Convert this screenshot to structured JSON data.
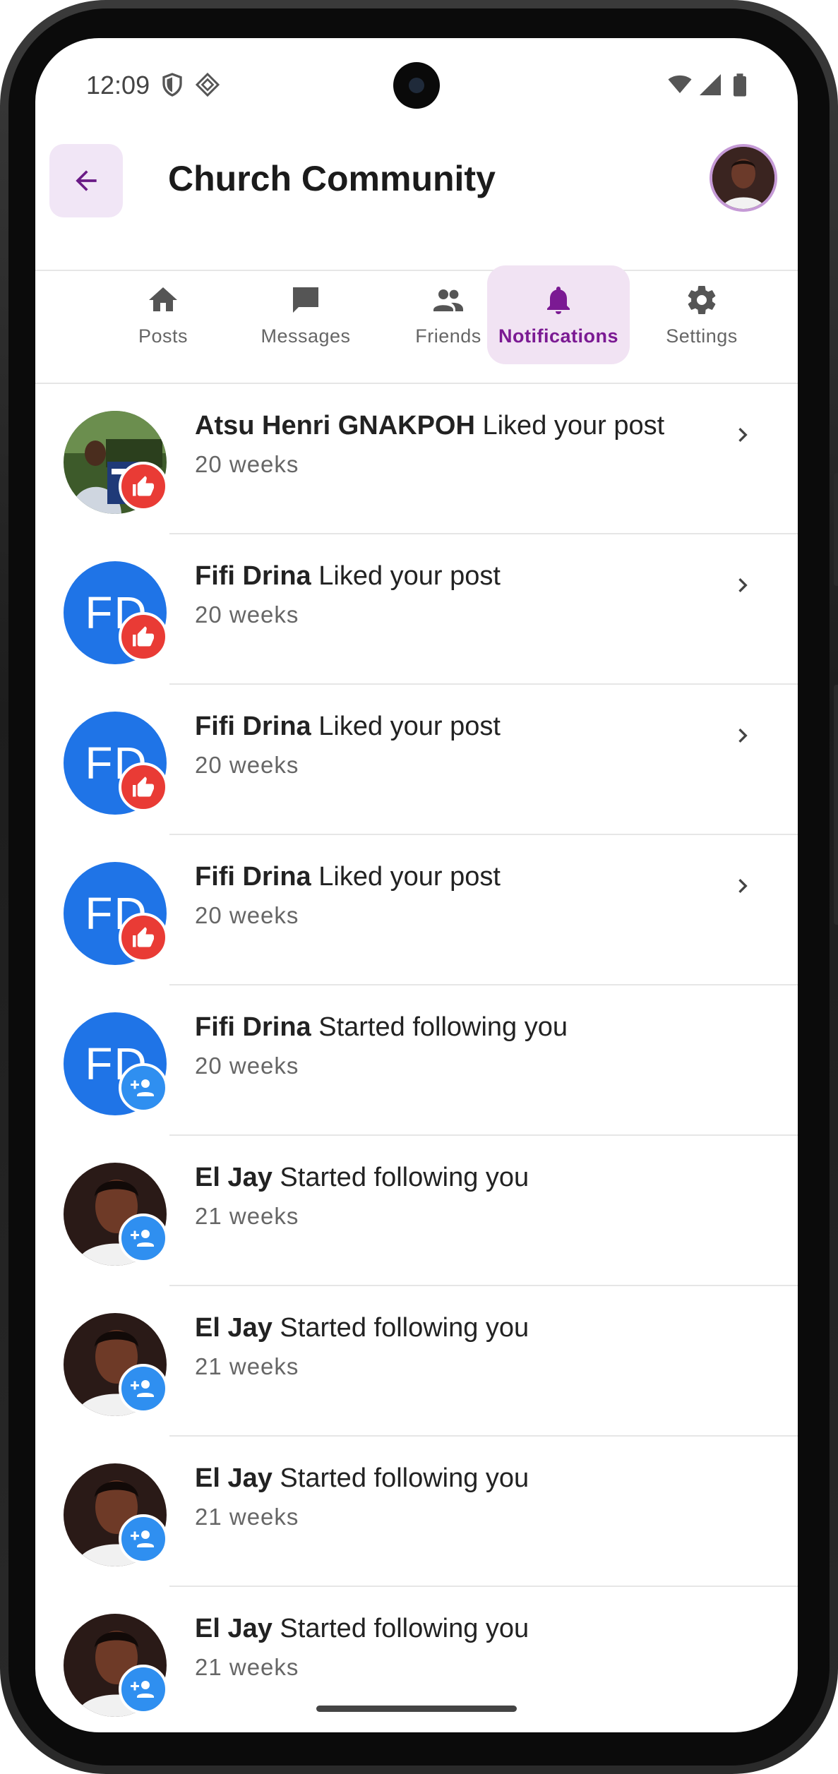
{
  "status_bar": {
    "time": "12:09"
  },
  "app_bar": {
    "title": "Church Community"
  },
  "tabs": [
    {
      "label": "Posts",
      "icon": "home-icon",
      "active": false
    },
    {
      "label": "Messages",
      "icon": "message-icon",
      "active": false
    },
    {
      "label": "Friends",
      "icon": "people-icon",
      "active": false
    },
    {
      "label": "Notifications",
      "icon": "bell-icon",
      "active": true
    },
    {
      "label": "Settings",
      "icon": "gear-icon",
      "active": false
    }
  ],
  "colors": {
    "accent": "#7b1a93",
    "accent_bg": "#f1e3f3",
    "avatar_blue": "#1f74e7",
    "like_red": "#e93b35",
    "follow_blue": "#2f8ff0"
  },
  "notifications": [
    {
      "name": "Atsu Henri GNAKPOH",
      "action": " Liked your post",
      "time": "20 weeks",
      "type": "like",
      "avatar": "photo-church",
      "chevron": true
    },
    {
      "name": "Fifi Drina",
      "action": " Liked your post",
      "time": "20 weeks",
      "type": "like",
      "avatar": "initials",
      "initials": "FD",
      "chevron": true
    },
    {
      "name": "Fifi Drina",
      "action": " Liked your post",
      "time": "20 weeks",
      "type": "like",
      "avatar": "initials",
      "initials": "FD",
      "chevron": true
    },
    {
      "name": "Fifi Drina",
      "action": " Liked your post",
      "time": "20 weeks",
      "type": "like",
      "avatar": "initials",
      "initials": "FD",
      "chevron": true
    },
    {
      "name": "Fifi Drina",
      "action": " Started following you",
      "time": "20 weeks",
      "type": "follow",
      "avatar": "initials",
      "initials": "FD",
      "chevron": false
    },
    {
      "name": "El Jay",
      "action": " Started following you",
      "time": "21 weeks",
      "type": "follow",
      "avatar": "photo-man",
      "chevron": false
    },
    {
      "name": "El Jay",
      "action": " Started following you",
      "time": "21 weeks",
      "type": "follow",
      "avatar": "photo-man",
      "chevron": false
    },
    {
      "name": "El Jay",
      "action": " Started following you",
      "time": "21 weeks",
      "type": "follow",
      "avatar": "photo-man",
      "chevron": false
    },
    {
      "name": "El Jay",
      "action": " Started following you",
      "time": "21 weeks",
      "type": "follow",
      "avatar": "photo-man",
      "chevron": false
    }
  ]
}
